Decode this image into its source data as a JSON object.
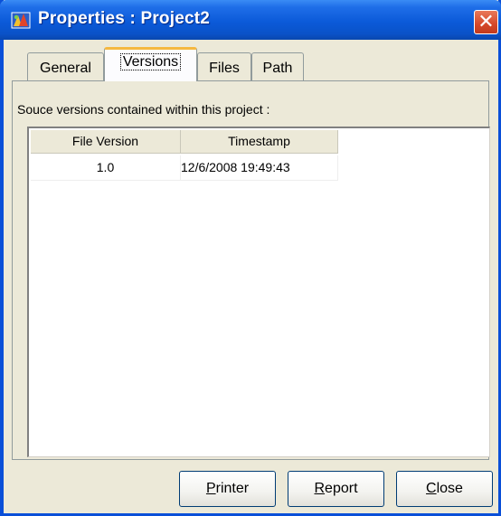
{
  "window": {
    "title": "Properties : Project2",
    "close_glyph": "✕"
  },
  "tabs": [
    {
      "label": "General",
      "active": false
    },
    {
      "label": "Versions",
      "active": true
    },
    {
      "label": "Files",
      "active": false
    },
    {
      "label": "Path",
      "active": false
    }
  ],
  "versions_panel": {
    "description": "Souce versions contained within this project :",
    "columns": [
      "File Version",
      "Timestamp"
    ],
    "rows": [
      {
        "file_version": "1.0",
        "timestamp": "12/6/2008 19:49:43"
      }
    ]
  },
  "buttons": {
    "printer": {
      "label": "Printer",
      "accel": "P",
      "rest": "rinter"
    },
    "report": {
      "label": "Report",
      "accel": "R",
      "rest": "eport"
    },
    "close": {
      "label": "Close",
      "accel": "C",
      "rest": "lose"
    }
  },
  "colors": {
    "titlebar": "#0a52c8",
    "dialog_bg": "#ece9d8",
    "active_tab_highlight": "#f5b840",
    "close_button": "#d5482a"
  },
  "icons": {
    "app": "project-properties-icon",
    "close": "close-icon"
  }
}
